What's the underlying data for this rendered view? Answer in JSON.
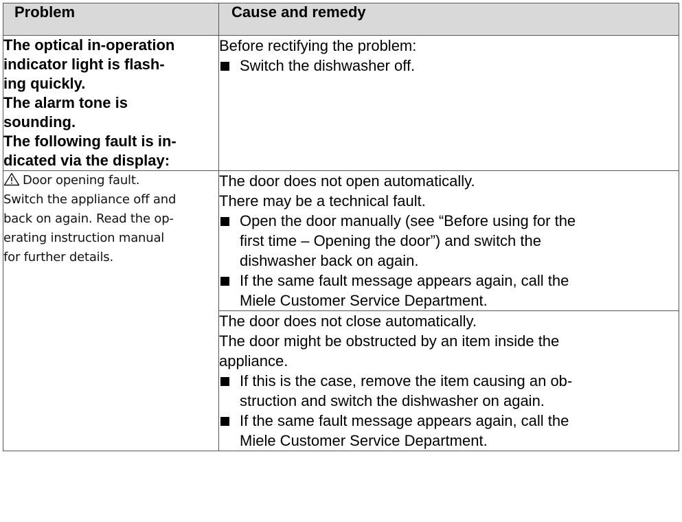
{
  "header": {
    "problem_label": "Problem",
    "cause_label": "Cause and remedy"
  },
  "row1": {
    "problem_lines": [
      "The optical in-operation",
      "indicator light is flash-",
      "ing quickly.",
      "The alarm tone is",
      "sounding.",
      "The following fault is in-",
      "dicated via the display:"
    ],
    "cause_intro": "Before rectifying the problem:",
    "bullets": [
      "Switch the dishwasher off."
    ]
  },
  "row2": {
    "display_icon": "warning-triangle-icon",
    "display_lines": [
      "Door opening fault.",
      "Switch the appliance off and",
      "back on again. Read the op-",
      "erating instruction manual",
      "for further details."
    ],
    "cause_lines": [
      "The door does not open automatically.",
      "There may be a technical fault."
    ],
    "bullets": [
      [
        "Open the door manually (see “Before using for the",
        "first time – Opening the door”) and switch the",
        "dishwasher back on again."
      ],
      [
        "If the same fault message appears again, call the",
        "Miele Customer Service Department."
      ]
    ]
  },
  "row3": {
    "cause_lines": [
      "The door does not close automatically.",
      "The door might be obstructed by an item inside the",
      "appliance."
    ],
    "bullets": [
      [
        "If this is the case, remove the item causing an ob-",
        "struction and switch the dishwasher on again."
      ],
      [
        "If the same fault message appears again, call the",
        "Miele Customer Service Department."
      ]
    ]
  }
}
